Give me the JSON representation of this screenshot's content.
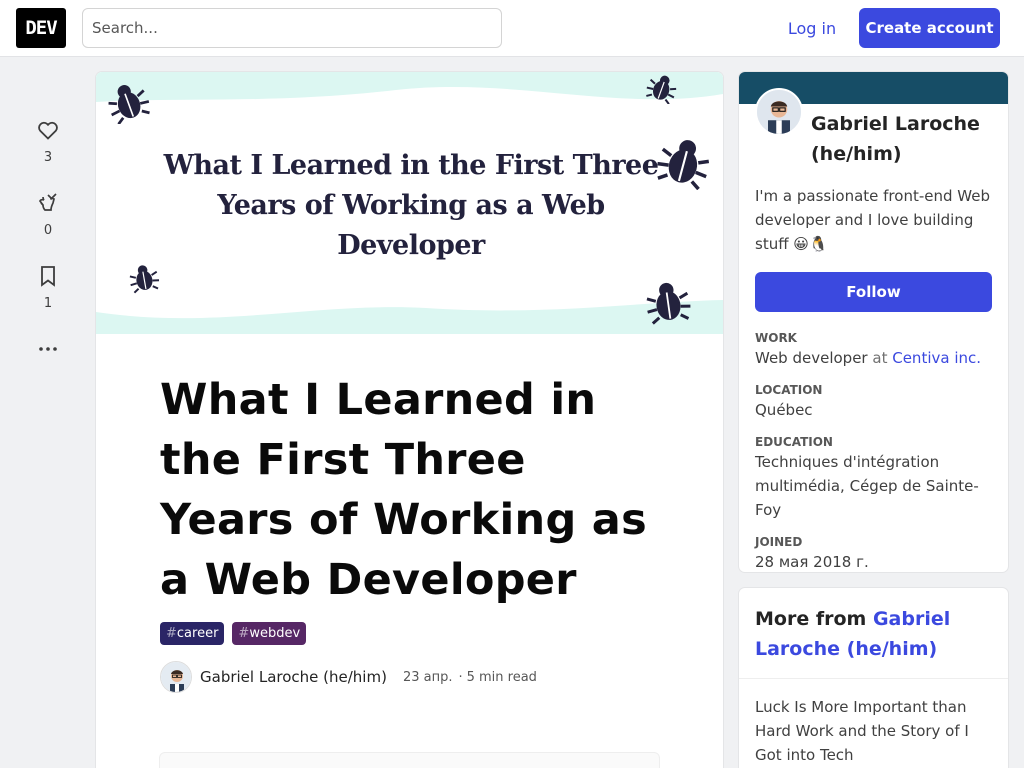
{
  "header": {
    "logo": "DEV",
    "search_placeholder": "Search...",
    "login_label": "Log in",
    "create_account_label": "Create account",
    "accent_color": "#3b49df"
  },
  "rail": {
    "reactions": [
      {
        "icon": "heart-icon",
        "count": "3"
      },
      {
        "icon": "unicorn-icon",
        "count": "0"
      },
      {
        "icon": "bookmark-icon",
        "count": "1"
      }
    ],
    "more_icon": "more-horizontal-icon"
  },
  "article": {
    "cover_title": "What I Learned in the First Three Years of Working as a Web Developer",
    "title": "What I Learned in the First Three Years of Working as a Web Developer",
    "tags": [
      {
        "hash": "#",
        "name": "career",
        "color": "#2a2566"
      },
      {
        "hash": "#",
        "name": "webdev",
        "color": "#562765"
      }
    ],
    "author": "Gabriel Laroche (he/him)",
    "date": "23 апр.",
    "read_time": "5 min read"
  },
  "profile": {
    "name": "Gabriel Laroche (he/him)",
    "bio": "I'm a passionate front-end Web developer and I love building stuff 😀🐧",
    "follow_label": "Follow",
    "work_label": "Work",
    "work_value": "Web developer",
    "work_at": "at",
    "work_company": "Centiva inc.",
    "location_label": "Location",
    "location_value": "Québec",
    "education_label": "Education",
    "education_value": "Techniques d'intégration multimédia, Cégep de Sainte-Foy",
    "joined_label": "Joined",
    "joined_value": "28 мая 2018 г.",
    "band_color": "#164d66"
  },
  "more_from": {
    "prefix": "More from",
    "author_link": "Gabriel Laroche (he/him)",
    "items": [
      "Luck Is More Important than Hard Work and the Story of I Got into Tech"
    ]
  }
}
